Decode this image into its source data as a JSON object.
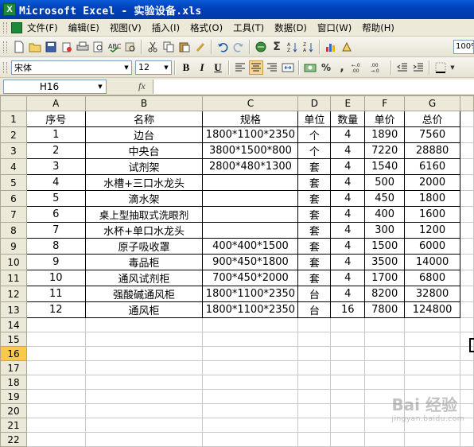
{
  "window": {
    "title": "Microsoft Excel - 实验设备.xls"
  },
  "menu": [
    "文件(F)",
    "编辑(E)",
    "视图(V)",
    "插入(I)",
    "格式(O)",
    "工具(T)",
    "数据(D)",
    "窗口(W)",
    "帮助(H)"
  ],
  "toolbar": {
    "zoom": "100%",
    "font_name": "宋体",
    "font_size": "12",
    "bold": "B",
    "italic": "I",
    "underline": "U",
    "sum": "Σ",
    "percent": "%",
    "thousands": ",",
    "inc_decimal": "+.0 .00",
    "dec_decimal": ".00 +.0"
  },
  "formula_bar": {
    "name_box": "H16",
    "fx": "fx",
    "content": ""
  },
  "columns": [
    "A",
    "B",
    "C",
    "D",
    "E",
    "F",
    "G"
  ],
  "sheet": {
    "headers": [
      "序号",
      "名称",
      "规格",
      "单位",
      "数量",
      "单价",
      "总价"
    ],
    "rows": [
      [
        "1",
        "边台",
        "1800*1100*2350",
        "个",
        "4",
        "1890",
        "7560"
      ],
      [
        "2",
        "中央台",
        "3800*1500*800",
        "个",
        "4",
        "7220",
        "28880"
      ],
      [
        "3",
        "试剂架",
        "2800*480*1300",
        "套",
        "4",
        "1540",
        "6160"
      ],
      [
        "4",
        "水槽+三口水龙头",
        "",
        "套",
        "4",
        "500",
        "2000"
      ],
      [
        "5",
        "滴水架",
        "",
        "套",
        "4",
        "450",
        "1800"
      ],
      [
        "6",
        "桌上型抽取式洗眼剂",
        "",
        "套",
        "4",
        "400",
        "1600"
      ],
      [
        "7",
        "水杯+单口水龙头",
        "",
        "套",
        "4",
        "300",
        "1200"
      ],
      [
        "8",
        "原子吸收罩",
        "400*400*1500",
        "套",
        "4",
        "1500",
        "6000"
      ],
      [
        "9",
        "毒品柜",
        "900*450*1800",
        "套",
        "4",
        "3500",
        "14000"
      ],
      [
        "10",
        "通风试剂柜",
        "700*450*2000",
        "套",
        "4",
        "1700",
        "6800"
      ],
      [
        "11",
        "强酸碱通风柜",
        "1800*1100*2350",
        "台",
        "4",
        "8200",
        "32800"
      ],
      [
        "12",
        "通风柜",
        "1800*1100*2350",
        "台",
        "16",
        "7800",
        "124800"
      ]
    ],
    "row_numbers": [
      "1",
      "2",
      "3",
      "4",
      "5",
      "6",
      "7",
      "8",
      "9",
      "10",
      "11",
      "12",
      "13",
      "14",
      "15",
      "16",
      "17",
      "18",
      "19",
      "20",
      "21",
      "22"
    ],
    "active_row": "16"
  },
  "watermark": {
    "text": "Bai 经验",
    "sub": "jingyan.baidu.com"
  }
}
